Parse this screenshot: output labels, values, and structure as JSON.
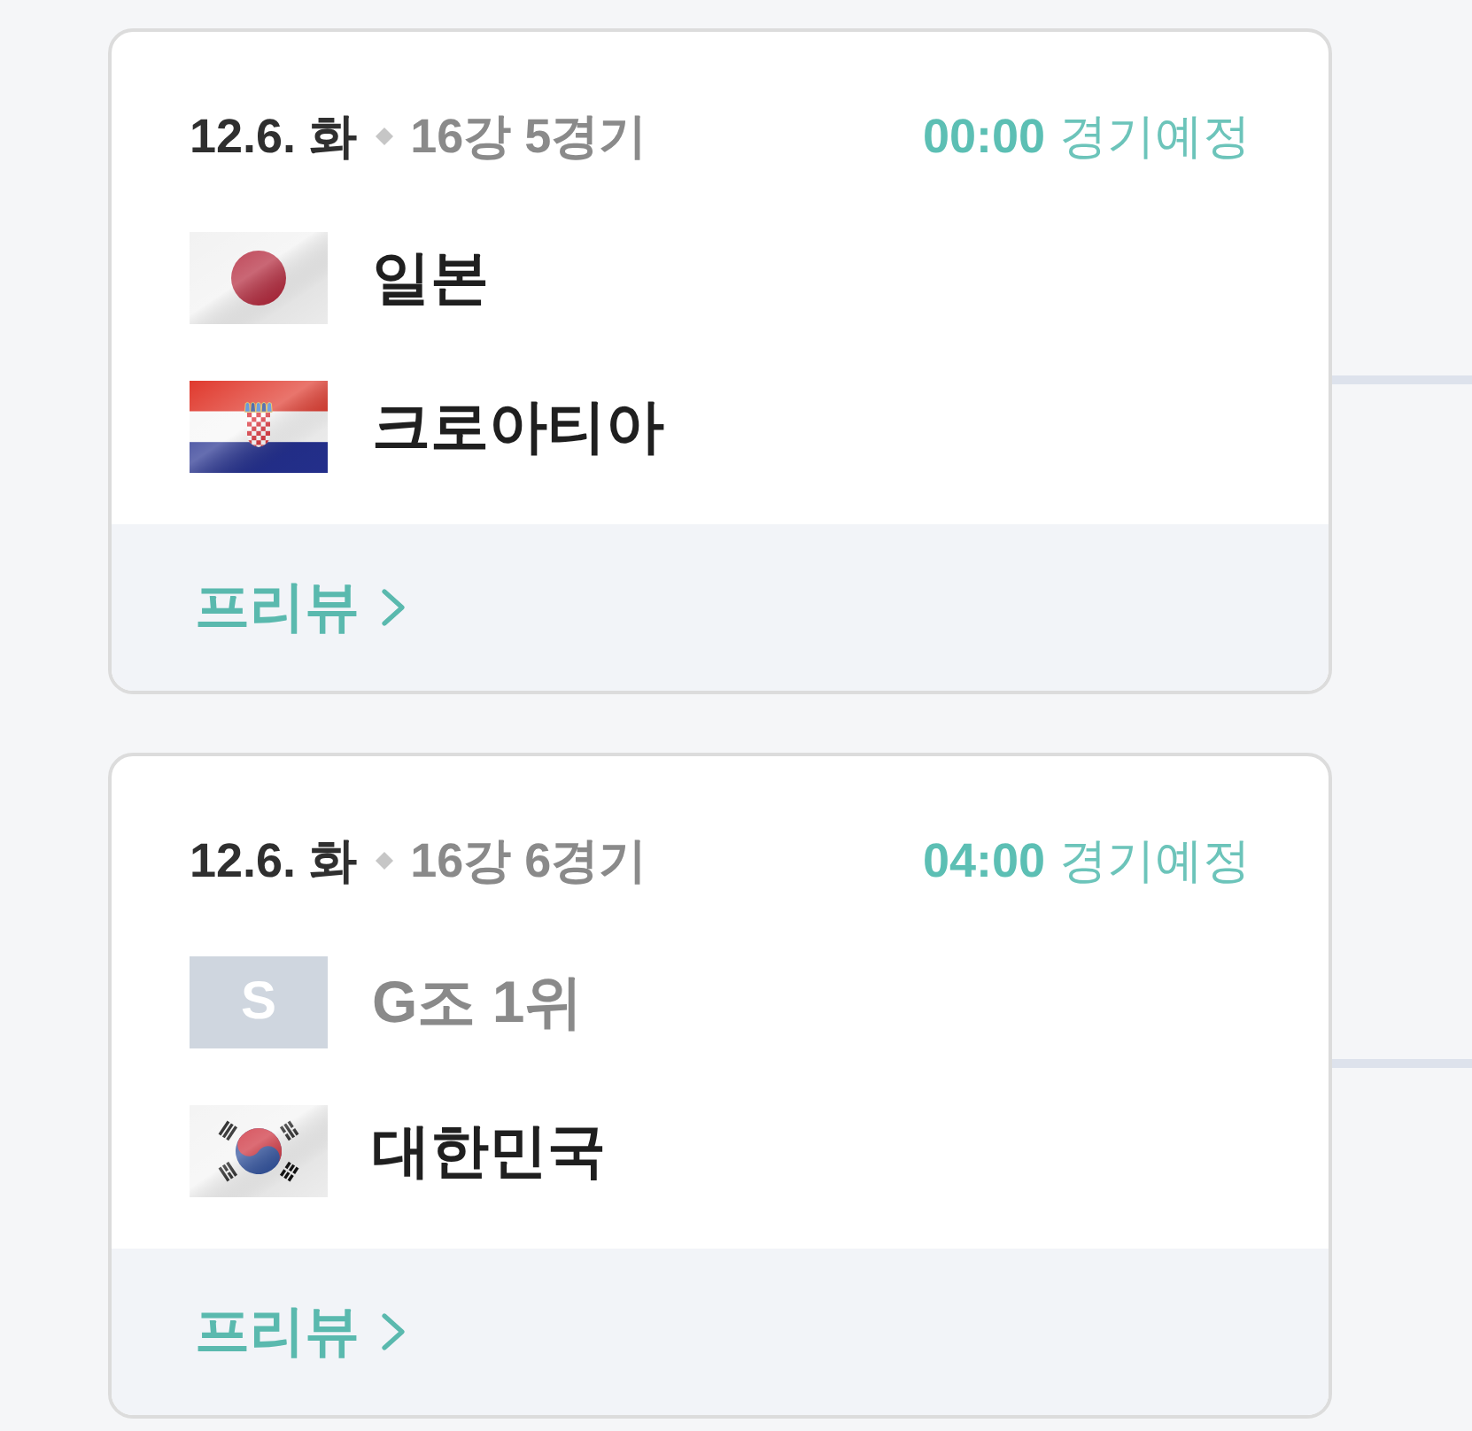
{
  "matches": [
    {
      "date": "12.6. 화",
      "round": "16강 5경기",
      "time": "00:00",
      "status": "경기예정",
      "teams": [
        {
          "kind": "japan",
          "name": "일본"
        },
        {
          "kind": "croatia",
          "name": "크로아티아"
        }
      ],
      "link": "프리뷰"
    },
    {
      "date": "12.6. 화",
      "round": "16강 6경기",
      "time": "04:00",
      "status": "경기예정",
      "teams": [
        {
          "kind": "placeholder",
          "emblem": "S",
          "name": "G조 1위"
        },
        {
          "kind": "korea",
          "name": "대한민국"
        }
      ],
      "link": "프리뷰"
    }
  ]
}
